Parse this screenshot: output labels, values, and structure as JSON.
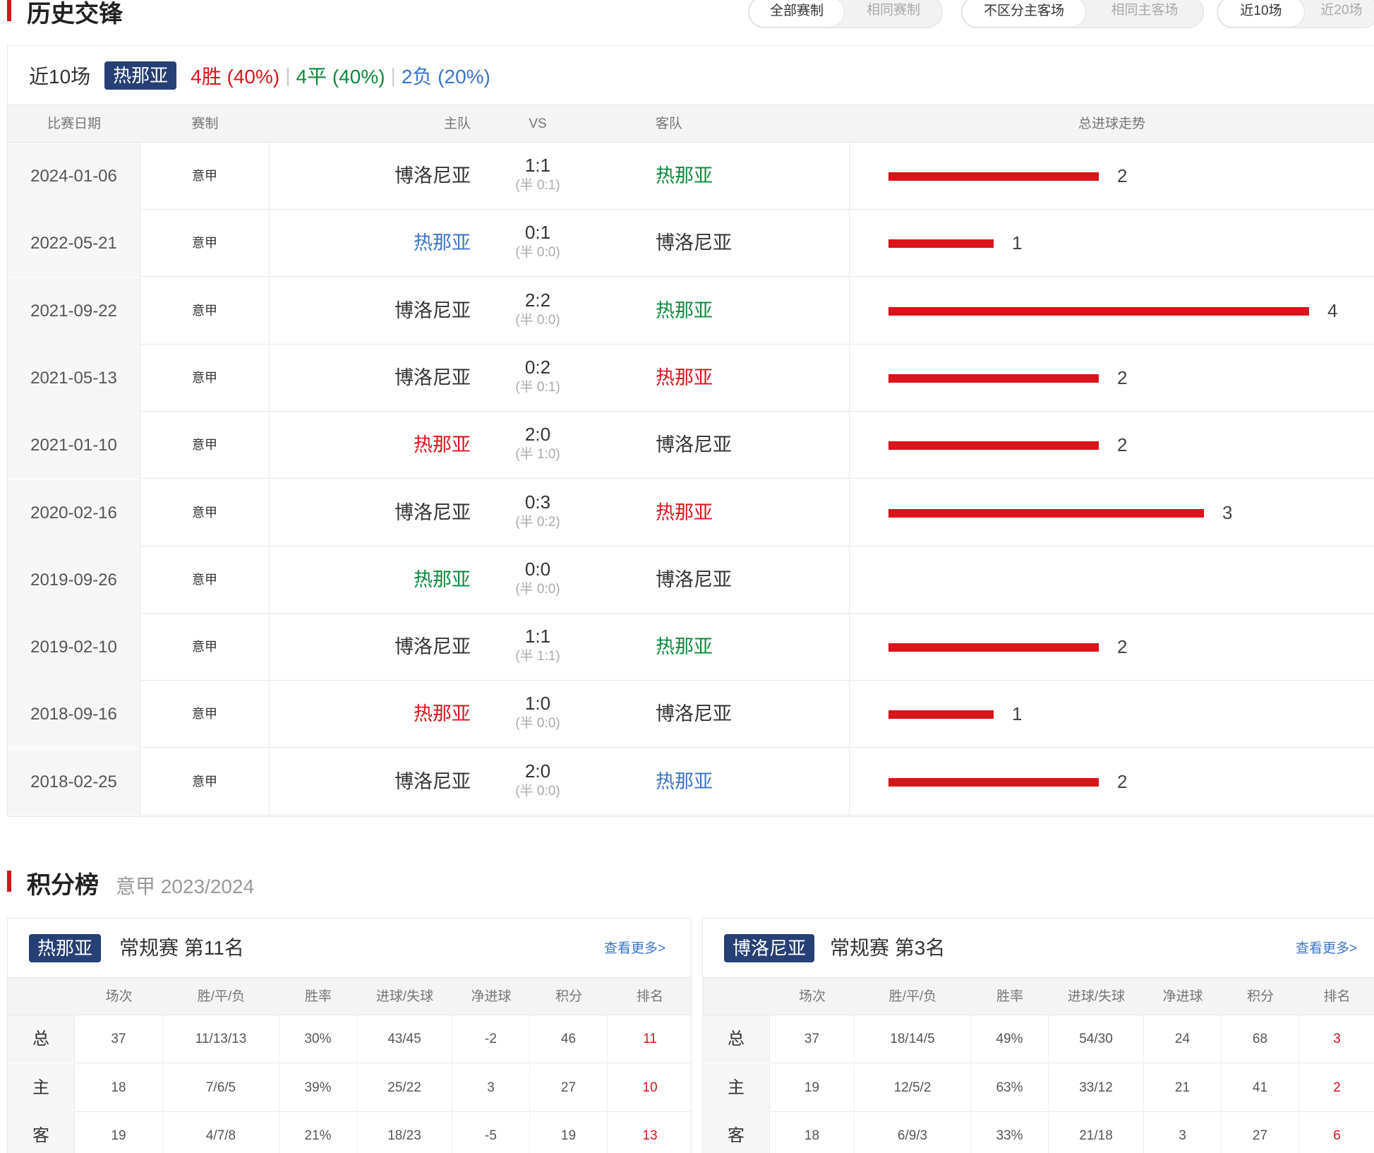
{
  "h2h": {
    "title": "历史交锋",
    "filters": [
      {
        "left": "全部赛制",
        "right": "相同赛制"
      },
      {
        "left": "不区分主客场",
        "right": "相同主客场"
      },
      {
        "left": "近10场",
        "right": "近20场"
      }
    ],
    "summary": {
      "label": "近10场",
      "team": "热那亚",
      "wins": "4胜 (40%)",
      "draws": "4平 (40%)",
      "losses": "2负 (20%)"
    },
    "columns": {
      "date": "比赛日期",
      "comp": "赛制",
      "home": "主队",
      "vs": "VS",
      "away": "客队",
      "trend": "总进球走势"
    },
    "rows": [
      {
        "date": "2024-01-06",
        "comp": "意甲",
        "home": "博洛尼亚",
        "home_color": "black",
        "score": "1:1",
        "half": "(半 0:1)",
        "away": "热那亚",
        "away_color": "green",
        "total": 2,
        "total_label": "2"
      },
      {
        "date": "2022-05-21",
        "comp": "意甲",
        "home": "热那亚",
        "home_color": "blue",
        "score": "0:1",
        "half": "(半 0:0)",
        "away": "博洛尼亚",
        "away_color": "black",
        "total": 1,
        "total_label": "1"
      },
      {
        "date": "2021-09-22",
        "comp": "意甲",
        "home": "博洛尼亚",
        "home_color": "black",
        "score": "2:2",
        "half": "(半 0:0)",
        "away": "热那亚",
        "away_color": "green",
        "total": 4,
        "total_label": "4"
      },
      {
        "date": "2021-05-13",
        "comp": "意甲",
        "home": "博洛尼亚",
        "home_color": "black",
        "score": "0:2",
        "half": "(半 0:1)",
        "away": "热那亚",
        "away_color": "red",
        "total": 2,
        "total_label": "2"
      },
      {
        "date": "2021-01-10",
        "comp": "意甲",
        "home": "热那亚",
        "home_color": "red",
        "score": "2:0",
        "half": "(半 1:0)",
        "away": "博洛尼亚",
        "away_color": "black",
        "total": 2,
        "total_label": "2"
      },
      {
        "date": "2020-02-16",
        "comp": "意甲",
        "home": "博洛尼亚",
        "home_color": "black",
        "score": "0:3",
        "half": "(半 0:2)",
        "away": "热那亚",
        "away_color": "red",
        "total": 3,
        "total_label": "3"
      },
      {
        "date": "2019-09-26",
        "comp": "意甲",
        "home": "热那亚",
        "home_color": "green",
        "score": "0:0",
        "half": "(半 0:0)",
        "away": "博洛尼亚",
        "away_color": "black",
        "total": 0,
        "total_label": ""
      },
      {
        "date": "2019-02-10",
        "comp": "意甲",
        "home": "博洛尼亚",
        "home_color": "black",
        "score": "1:1",
        "half": "(半 1:1)",
        "away": "热那亚",
        "away_color": "green",
        "total": 2,
        "total_label": "2"
      },
      {
        "date": "2018-09-16",
        "comp": "意甲",
        "home": "热那亚",
        "home_color": "red",
        "score": "1:0",
        "half": "(半 0:0)",
        "away": "博洛尼亚",
        "away_color": "black",
        "total": 1,
        "total_label": "1"
      },
      {
        "date": "2018-02-25",
        "comp": "意甲",
        "home": "博洛尼亚",
        "home_color": "black",
        "score": "2:0",
        "half": "(半 0:0)",
        "away": "热那亚",
        "away_color": "blue",
        "total": 2,
        "total_label": "2"
      }
    ]
  },
  "standings": {
    "title": "积分榜",
    "subtitle": "意甲 2023/2024",
    "columns": [
      "场次",
      "胜/平/负",
      "胜率",
      "进球/失球",
      "净进球",
      "积分",
      "排名"
    ],
    "tables": [
      {
        "team": "热那亚",
        "rank_text": "常规赛 第11名",
        "more": "查看更多>",
        "rows": [
          {
            "label": "总",
            "cells": [
              "37",
              "11/13/13",
              "30%",
              "43/45",
              "-2",
              "46",
              "11"
            ]
          },
          {
            "label": "主",
            "cells": [
              "18",
              "7/6/5",
              "39%",
              "25/22",
              "3",
              "27",
              "10"
            ]
          },
          {
            "label": "客",
            "cells": [
              "19",
              "4/7/8",
              "21%",
              "18/23",
              "-5",
              "19",
              "13"
            ]
          }
        ]
      },
      {
        "team": "博洛尼亚",
        "rank_text": "常规赛 第3名",
        "more": "查看更多>",
        "rows": [
          {
            "label": "总",
            "cells": [
              "37",
              "18/14/5",
              "49%",
              "54/30",
              "24",
              "68",
              "3"
            ]
          },
          {
            "label": "主",
            "cells": [
              "19",
              "12/5/2",
              "63%",
              "33/12",
              "21",
              "41",
              "2"
            ]
          },
          {
            "label": "客",
            "cells": [
              "18",
              "6/9/3",
              "33%",
              "21/18",
              "3",
              "27",
              "6"
            ]
          }
        ]
      }
    ]
  },
  "colors": {
    "accent_red": "#d9141a",
    "win_red": "#d9141a",
    "draw_green": "#0c8a3c",
    "loss_blue": "#3b74c9",
    "tag_navy": "#263f75"
  }
}
